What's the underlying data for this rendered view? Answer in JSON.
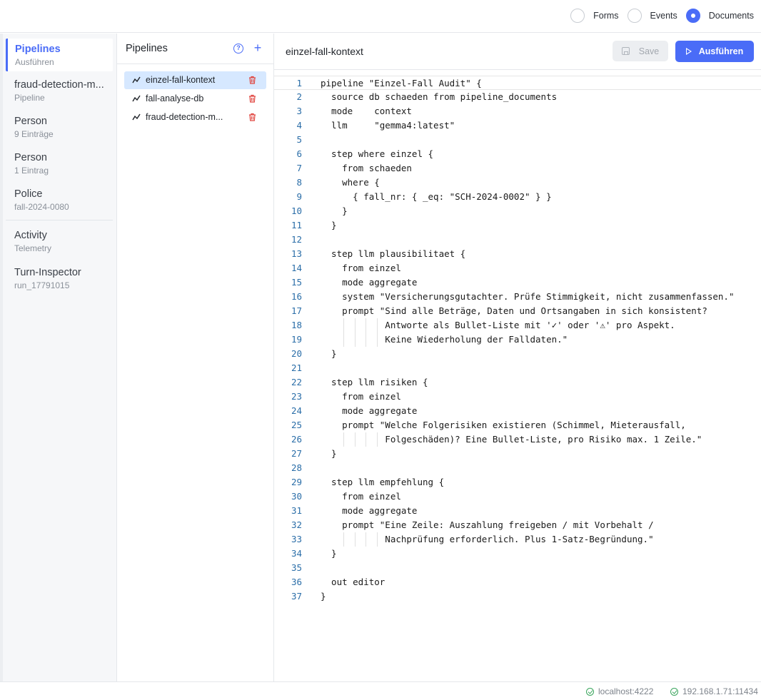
{
  "topbar": {
    "radios": [
      {
        "label": "Forms",
        "selected": false
      },
      {
        "label": "Events",
        "selected": false
      },
      {
        "label": "Documents",
        "selected": true
      }
    ]
  },
  "leftnav": {
    "items": [
      {
        "title": "Pipelines",
        "sub": "Ausführen",
        "active": true
      },
      {
        "title": "fraud-detection-m...",
        "sub": "Pipeline",
        "active": false
      },
      {
        "title": "Person",
        "sub": "9 Einträge",
        "active": false
      },
      {
        "title": "Person",
        "sub": "1 Eintrag",
        "active": false
      },
      {
        "title": "Police",
        "sub": "fall-2024-0080",
        "active": false
      },
      {
        "title": "Activity",
        "sub": "Telemetry",
        "active": false
      },
      {
        "title": "Turn-Inspector",
        "sub": "run_17791015",
        "active": false
      }
    ]
  },
  "pipelines": {
    "title": "Pipelines",
    "items": [
      {
        "name": "einzel-fall-kontext",
        "selected": true
      },
      {
        "name": "fall-analyse-db",
        "selected": false
      },
      {
        "name": "fraud-detection-m...",
        "selected": false
      }
    ]
  },
  "editor": {
    "title": "einzel-fall-kontext",
    "save_label": "Save",
    "run_label": "Ausführen",
    "lines": [
      "pipeline \"Einzel-Fall Audit\" {",
      "  source db schaeden from pipeline_documents",
      "  mode    context",
      "  llm     \"gemma4:latest\"",
      "",
      "  step where einzel {",
      "    from schaeden",
      "    where {",
      "      { fall_nr: { _eq: \"SCH-2024-0002\" } }",
      "    }",
      "  }",
      "",
      "  step llm plausibilitaet {",
      "    from einzel",
      "    mode aggregate",
      "    system \"Versicherungsgutachter. Prüfe Stimmigkeit, nicht zusammenfassen.\"",
      "    prompt \"Sind alle Beträge, Daten und Ortsangaben in sich konsistent?",
      "            Antworte als Bullet-Liste mit '✓' oder '⚠' pro Aspekt.",
      "            Keine Wiederholung der Falldaten.\"",
      "  }",
      "",
      "  step llm risiken {",
      "    from einzel",
      "    mode aggregate",
      "    prompt \"Welche Folgerisiken existieren (Schimmel, Mieterausfall,",
      "            Folgeschäden)? Eine Bullet-Liste, pro Risiko max. 1 Zeile.\"",
      "  }",
      "",
      "  step llm empfehlung {",
      "    from einzel",
      "    mode aggregate",
      "    prompt \"Eine Zeile: Auszahlung freigeben / mit Vorbehalt /",
      "            Nachprüfung erforderlich. Plus 1-Satz-Begründung.\"",
      "  }",
      "",
      "  out editor",
      "}"
    ]
  },
  "status": {
    "items": [
      "localhost:4222",
      "192.168.1.71:11434"
    ]
  }
}
